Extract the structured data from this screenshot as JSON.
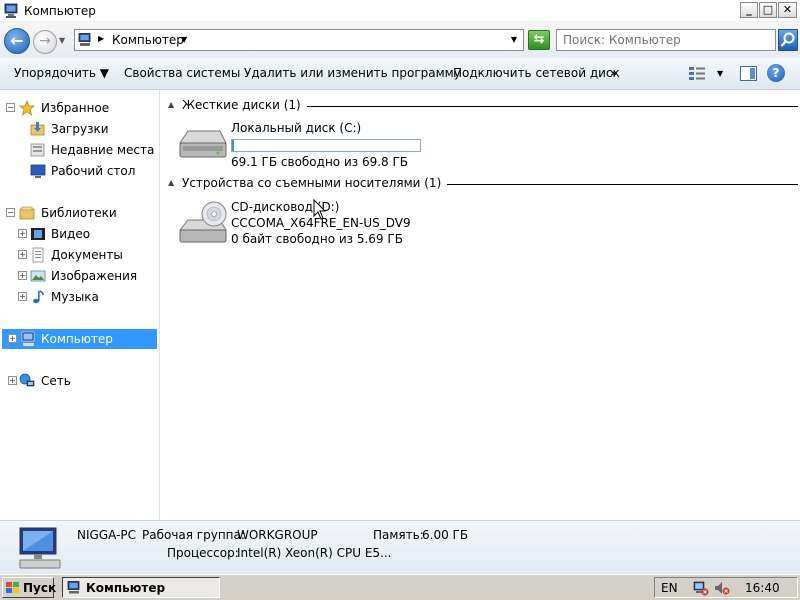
{
  "window": {
    "title": "Компьютер",
    "minimize_label": "_",
    "maximize_label": "□",
    "close_label": "✕"
  },
  "address": {
    "back_label": "←",
    "forward_label": "→",
    "history_arrow": "▼",
    "crumb_arrow": "▶",
    "crumb_label": "Компьютер",
    "crumb_drop": "▼",
    "addr_drop": "▼",
    "refresh_label": "⇆",
    "search_placeholder": "Поиск: Компьютер"
  },
  "toolbar": {
    "organize": "Упорядочить  ▼",
    "system_properties": "Свойства системы",
    "uninstall": "Удалить или изменить программу",
    "map_network_drive": "Подключить сетевой диск",
    "more": "»",
    "views_drop": "▼",
    "help": "?"
  },
  "nav": {
    "favorites": "Избранное",
    "downloads": "Загрузки",
    "recent_places": "Недавние места",
    "desktop": "Рабочий стол",
    "libraries": "Библиотеки",
    "video": "Видео",
    "documents": "Документы",
    "pictures": "Изображения",
    "music": "Музыка",
    "computer": "Компьютер",
    "network": "Сеть",
    "collapse_sign": "−",
    "expand_sign": "+"
  },
  "content": {
    "hard_disks_header": "Жесткие диски (1)",
    "removable_header": "Устройства со съемными носителями (1)",
    "group_toggle": "▲",
    "local_disk": {
      "name": "Локальный диск (C:)",
      "free_text": "69.1 ГБ свободно из 69.8 ГБ",
      "used_fraction": 0.01
    },
    "cd_drive": {
      "name": "CD-дисковод (D:)",
      "label": "CCCOMA_X64FRE_EN-US_DV9",
      "free_text": "0 байт свободно из 5.69 ГБ"
    }
  },
  "details": {
    "pc_name": "NIGGA-PC",
    "workgroup_label": "Рабочая группа:",
    "workgroup_value": "WORKGROUP",
    "memory_label": "Память:",
    "memory_value": "6.00 ГБ",
    "cpu_label": "Процессор:",
    "cpu_value": "Intel(R) Xeon(R) CPU E5..."
  },
  "taskbar": {
    "start_label": "Пуск",
    "window_button": "Компьютер",
    "language": "EN",
    "clock": "16:40"
  },
  "colors": {
    "selection": "#3399ff",
    "accent_blue": "#1d64b8"
  }
}
